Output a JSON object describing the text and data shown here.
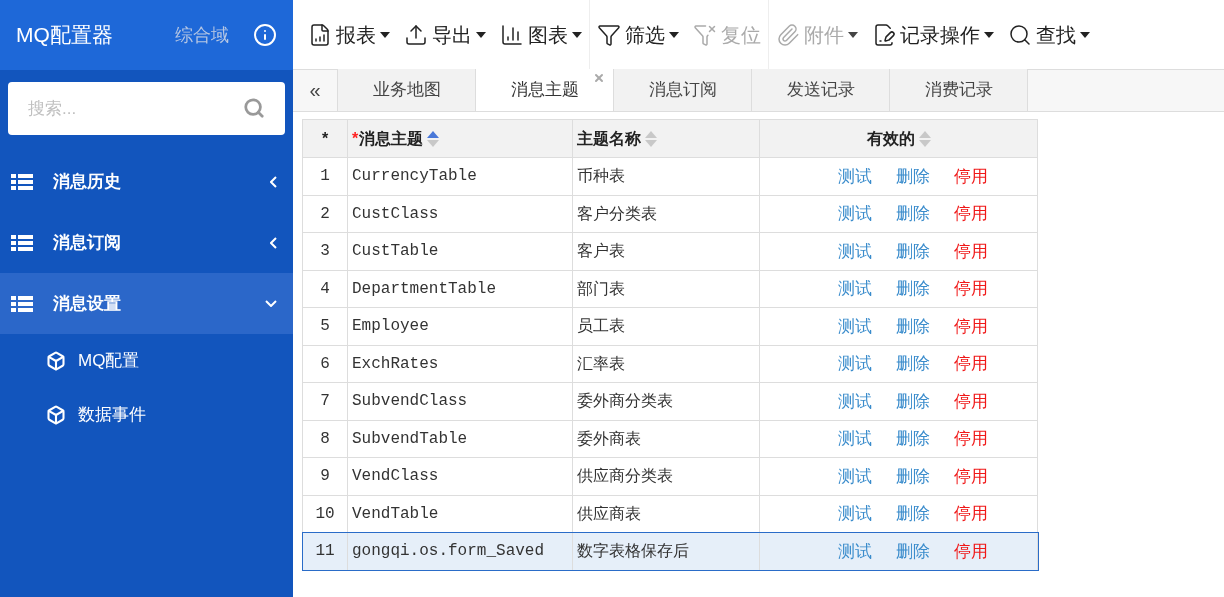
{
  "app": {
    "title": "MQ配置器",
    "domain": "综合域"
  },
  "search": {
    "placeholder": "搜索..."
  },
  "nav": [
    {
      "label": "消息历史",
      "expanded": false
    },
    {
      "label": "消息订阅",
      "expanded": false
    },
    {
      "label": "消息设置",
      "expanded": true,
      "children": [
        {
          "label": "MQ配置"
        },
        {
          "label": "数据事件"
        }
      ]
    }
  ],
  "toolbar": [
    {
      "label": "报表",
      "disabled": false,
      "dropdown": true
    },
    {
      "label": "导出",
      "disabled": false,
      "dropdown": true
    },
    {
      "label": "图表",
      "disabled": false,
      "dropdown": true
    },
    {
      "label": "筛选",
      "disabled": false,
      "dropdown": true
    },
    {
      "label": "复位",
      "disabled": true,
      "dropdown": false
    },
    {
      "label": "附件",
      "disabled": true,
      "dropdown": true
    },
    {
      "label": "记录操作",
      "disabled": false,
      "dropdown": true
    },
    {
      "label": "查找",
      "disabled": false,
      "dropdown": true
    }
  ],
  "collapse_button": "«",
  "tabs": [
    {
      "label": "业务地图",
      "selected": false,
      "closable": false
    },
    {
      "label": "消息主题",
      "selected": true,
      "closable": true
    },
    {
      "label": "消息订阅",
      "selected": false,
      "closable": false
    },
    {
      "label": "发送记录",
      "selected": false,
      "closable": false
    },
    {
      "label": "消费记录",
      "selected": false,
      "closable": false
    }
  ],
  "table": {
    "columns": [
      {
        "label": "*"
      },
      {
        "label": "消息主题",
        "mark": "*",
        "sort_ascending": true
      },
      {
        "label": "主题名称",
        "sort_ascending": false
      },
      {
        "label": "有效的",
        "sort_ascending": false
      }
    ],
    "rows": [
      {
        "n": "1",
        "topic": "CurrencyTable",
        "name": "币种表",
        "selected": false,
        "actions": [
          {
            "label": "测试",
            "kind": "link"
          },
          {
            "label": "删除",
            "kind": "link"
          },
          {
            "label": "停用",
            "kind": "danger"
          }
        ]
      },
      {
        "n": "2",
        "topic": "CustClass",
        "name": "客户分类表",
        "selected": false,
        "actions": [
          {
            "label": "测试",
            "kind": "link"
          },
          {
            "label": "删除",
            "kind": "link"
          },
          {
            "label": "停用",
            "kind": "danger"
          }
        ]
      },
      {
        "n": "3",
        "topic": "CustTable",
        "name": "客户表",
        "selected": false,
        "actions": [
          {
            "label": "测试",
            "kind": "link"
          },
          {
            "label": "删除",
            "kind": "link"
          },
          {
            "label": "停用",
            "kind": "danger"
          }
        ]
      },
      {
        "n": "4",
        "topic": "DepartmentTable",
        "name": "部门表",
        "selected": false,
        "actions": [
          {
            "label": "测试",
            "kind": "link"
          },
          {
            "label": "删除",
            "kind": "link"
          },
          {
            "label": "停用",
            "kind": "danger"
          }
        ]
      },
      {
        "n": "5",
        "topic": "Employee",
        "name": "员工表",
        "selected": false,
        "actions": [
          {
            "label": "测试",
            "kind": "link"
          },
          {
            "label": "删除",
            "kind": "link"
          },
          {
            "label": "停用",
            "kind": "danger"
          }
        ]
      },
      {
        "n": "6",
        "topic": "ExchRates",
        "name": "汇率表",
        "selected": false,
        "actions": [
          {
            "label": "测试",
            "kind": "link"
          },
          {
            "label": "删除",
            "kind": "link"
          },
          {
            "label": "停用",
            "kind": "danger"
          }
        ]
      },
      {
        "n": "7",
        "topic": "SubvendClass",
        "name": "委外商分类表",
        "selected": false,
        "actions": [
          {
            "label": "测试",
            "kind": "link"
          },
          {
            "label": "删除",
            "kind": "link"
          },
          {
            "label": "停用",
            "kind": "danger"
          }
        ]
      },
      {
        "n": "8",
        "topic": "SubvendTable",
        "name": "委外商表",
        "selected": false,
        "actions": [
          {
            "label": "测试",
            "kind": "link"
          },
          {
            "label": "删除",
            "kind": "link"
          },
          {
            "label": "停用",
            "kind": "danger"
          }
        ]
      },
      {
        "n": "9",
        "topic": "VendClass",
        "name": "供应商分类表",
        "selected": false,
        "actions": [
          {
            "label": "测试",
            "kind": "link"
          },
          {
            "label": "删除",
            "kind": "link"
          },
          {
            "label": "停用",
            "kind": "danger"
          }
        ]
      },
      {
        "n": "10",
        "topic": "VendTable",
        "name": "供应商表",
        "selected": false,
        "actions": [
          {
            "label": "测试",
            "kind": "link"
          },
          {
            "label": "删除",
            "kind": "link"
          },
          {
            "label": "停用",
            "kind": "danger"
          }
        ]
      },
      {
        "n": "11",
        "topic": "gongqi.os.form_Saved",
        "name": "数字表格保存后",
        "selected": true,
        "actions": [
          {
            "label": "测试",
            "kind": "link"
          },
          {
            "label": "删除",
            "kind": "link"
          },
          {
            "label": "停用",
            "kind": "danger"
          }
        ]
      }
    ]
  }
}
